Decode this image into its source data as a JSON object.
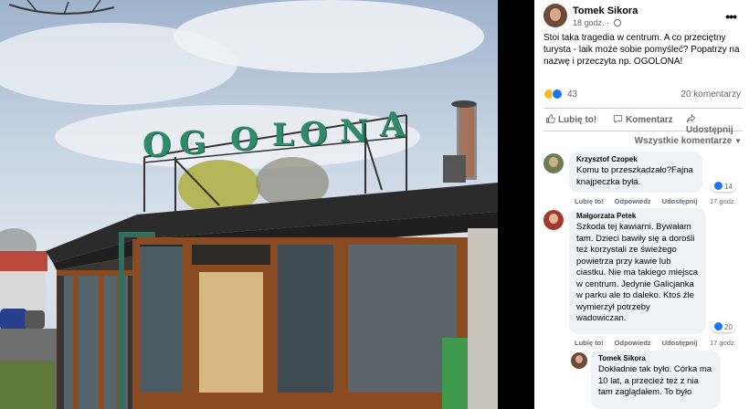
{
  "photo": {
    "sign_letters": [
      "O",
      "G",
      "O",
      "L",
      "O",
      "N",
      "A"
    ]
  },
  "post": {
    "author": "Tomek Sikora",
    "time": "18 godz.",
    "text": "Stoi taka tragedia w centrum. A co przeciętny turysta - laik może sobie pomyśleć? Popatrzy na nazwę i przeczyta np. OGOLONA!",
    "reaction_count": "43",
    "comments_count": "20 komentarzy",
    "actions": {
      "like": "Lubię to!",
      "comment": "Komentarz",
      "share": "Udostępnij"
    },
    "sort_label": "Wszystkie komentarze"
  },
  "comments": [
    {
      "author": "Krzysztof Czopek",
      "text": "Komu to przeszkadzało?Fajna knajpeczka była.",
      "reactions": "14",
      "like": "Lubię to!",
      "reply": "Odpowiedz",
      "share": "Udostępnij",
      "time": "17 godz."
    },
    {
      "author": "Małgorzata Petek",
      "text": "Szkoda tej kawiarni. Bywałam tam. Dzieci bawiły się a dorośli też korzystali ze świeżego powietrza przy kawie lub ciastku. Nie ma takiego miejsca w centrum. Jedynie Galicjanka w parku ale to daleko. Ktoś źle wymierzył potrzeby wadowiczan.",
      "reactions": "20",
      "like": "Lubię to!",
      "reply": "Odpowiedz",
      "share": "Udostępnij",
      "time": "17 godz."
    },
    {
      "author": "Tomek Sikora",
      "text": "Dokładnie tak było. Córka ma 10 lat, a przecież też z nia tam zaglądałem. To było"
    }
  ],
  "colors": {
    "sign_green": "#2f8a6a",
    "like_blue": "#1877f2",
    "wood": "#8a4a22"
  }
}
